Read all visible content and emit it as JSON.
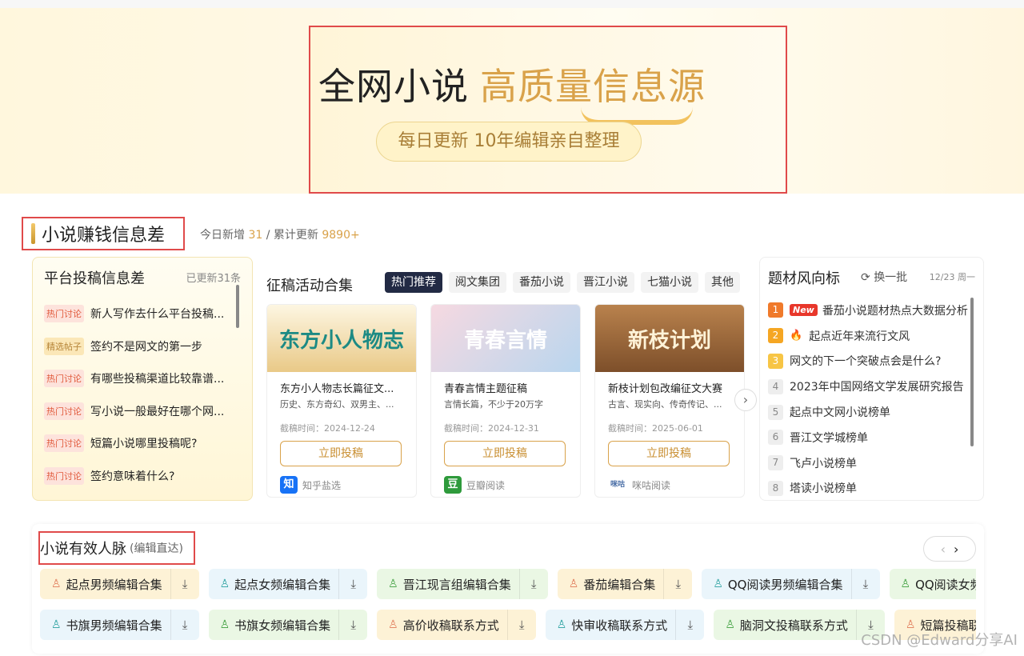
{
  "hero": {
    "title_a": "全网小说",
    "title_b": "高质量信息源",
    "pill": "每日更新 10年编辑亲自整理"
  },
  "section": {
    "title": "小说赚钱信息差",
    "stats_prefix": "今日新增",
    "today_count": "31",
    "stats_sep": " / 累计更新",
    "total_count": "9890+"
  },
  "platform": {
    "title": "平台投稿信息差",
    "updated": "已更新31条",
    "items": [
      {
        "tag": "热门讨论",
        "type": "hot",
        "text": "新人写作去什么平台投稿..."
      },
      {
        "tag": "精选帖子",
        "type": "sel",
        "text": "签约不是网文的第一步"
      },
      {
        "tag": "热门讨论",
        "type": "hot",
        "text": "有哪些投稿渠道比较靠谱..."
      },
      {
        "tag": "热门讨论",
        "type": "hot",
        "text": "写小说一般最好在哪个网..."
      },
      {
        "tag": "热门讨论",
        "type": "hot",
        "text": "短篇小说哪里投稿呢?"
      },
      {
        "tag": "热门讨论",
        "type": "hot",
        "text": "签约意味着什么?"
      }
    ]
  },
  "collect": {
    "title": "征稿活动合集",
    "tabs": [
      "热门推荐",
      "阅文集团",
      "番茄小说",
      "晋江小说",
      "七猫小说",
      "其他"
    ],
    "cards": [
      {
        "image_text": "东方小人物志",
        "title": "东方小人物志长篇征文...",
        "sub": "历史、东方奇幻、双男主、...",
        "date": "截稿时间：2024-12-24",
        "button": "立即投稿",
        "source_icon": "知",
        "source": "知乎盐选"
      },
      {
        "image_text": "青春言情",
        "title": "青春言情主题征稿",
        "sub": "言情长篇，不少于20万字",
        "date": "截稿时间：2024-12-31",
        "button": "立即投稿",
        "source_icon": "豆",
        "source": "豆瓣阅读"
      },
      {
        "image_text": "新枝计划",
        "title": "新枝计划包改编征文大赛",
        "sub": "古言、现实向、传奇传记、...",
        "date": "截稿时间：2025-06-01",
        "button": "立即投稿",
        "source_icon": "咪咕",
        "source": "咪咕阅读"
      }
    ]
  },
  "trend": {
    "title": "题材风向标",
    "swap": "换一批",
    "date": "12/23 周一",
    "new_badge": "New",
    "items": [
      {
        "rank": "1",
        "text": "番茄小说题材热点大数据分析"
      },
      {
        "rank": "2",
        "text": "起点近年来流行文风"
      },
      {
        "rank": "3",
        "text": "网文的下一个突破点会是什么?"
      },
      {
        "rank": "4",
        "text": "2023年中国网络文学发展研究报告"
      },
      {
        "rank": "5",
        "text": "起点中文网小说榜单"
      },
      {
        "rank": "6",
        "text": "晋江文学城榜单"
      },
      {
        "rank": "7",
        "text": "飞卢小说榜单"
      },
      {
        "rank": "8",
        "text": "塔读小说榜单"
      }
    ]
  },
  "contacts": {
    "title": "小说有效人脉",
    "subtitle": "(编辑直达)",
    "row1": [
      {
        "label": "起点男频编辑合集",
        "color": "y"
      },
      {
        "label": "起点女频编辑合集",
        "color": "b"
      },
      {
        "label": "晋江现言组编辑合集",
        "color": "g"
      },
      {
        "label": "番茄编辑合集",
        "color": "y"
      },
      {
        "label": "QQ阅读男频编辑合集",
        "color": "b"
      },
      {
        "label": "QQ阅读女频编辑合集",
        "color": "g"
      }
    ],
    "row2": [
      {
        "label": "书旗男频编辑合集",
        "color": "b"
      },
      {
        "label": "书旗女频编辑合集",
        "color": "g"
      },
      {
        "label": "高价收稿联系方式",
        "color": "y"
      },
      {
        "label": "快审收稿联系方式",
        "color": "b"
      },
      {
        "label": "脑洞文投稿联系方式",
        "color": "g"
      },
      {
        "label": "短篇投稿联系方式",
        "color": "y"
      }
    ]
  },
  "watermark": "CSDN @Edward分享AI"
}
